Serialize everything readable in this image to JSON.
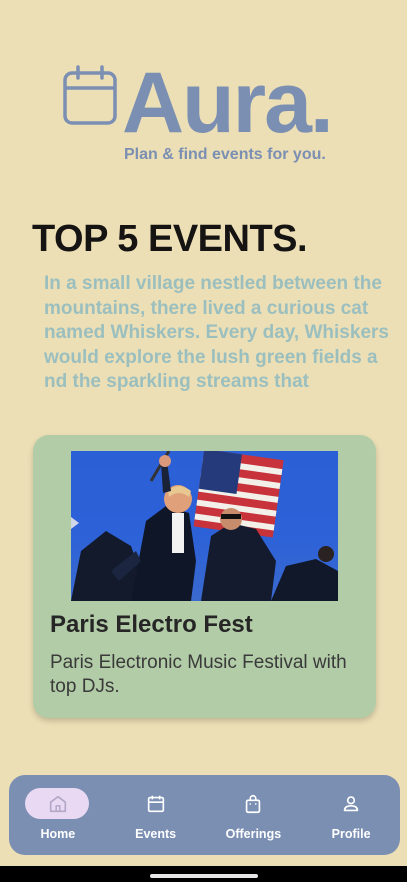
{
  "app": {
    "logo_text": "Aura.",
    "tagline": "Plan & find events for you.",
    "brand_color": "#7b8fb3"
  },
  "main": {
    "section_title": "TOP 5 EVENTS.",
    "intro_text": "In a small village nestled between the mountains, there lived a curious cat named Whiskers. Every day, Whiskers would explore the lush green fields a nd the sparkling streams that",
    "event_card": {
      "title": "Paris Electro Fest",
      "description": "Paris Electronic Music Festival with top DJs.",
      "image": "event-photo"
    }
  },
  "bottom_nav": {
    "items": [
      {
        "label": "Home",
        "icon": "home-icon",
        "active": true
      },
      {
        "label": "Events",
        "icon": "calendar-icon",
        "active": false
      },
      {
        "label": "Offerings",
        "icon": "shopping-bag-icon",
        "active": false
      },
      {
        "label": "Profile",
        "icon": "person-icon",
        "active": false
      }
    ]
  }
}
